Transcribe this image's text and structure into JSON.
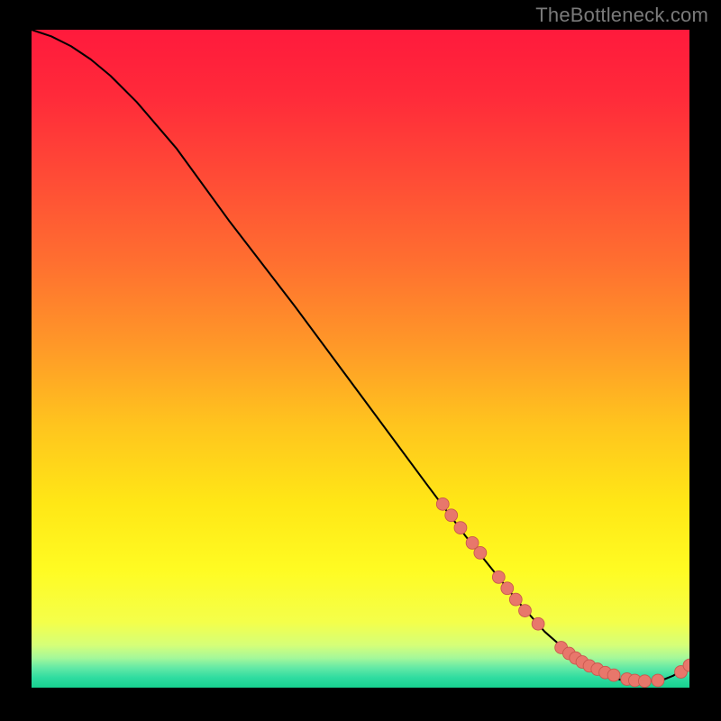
{
  "watermark": "TheBottleneck.com",
  "colors": {
    "gradient_stops": [
      {
        "offset": 0.0,
        "color": "#ff1a3c"
      },
      {
        "offset": 0.1,
        "color": "#ff2a3a"
      },
      {
        "offset": 0.22,
        "color": "#ff4a36"
      },
      {
        "offset": 0.35,
        "color": "#ff6e30"
      },
      {
        "offset": 0.48,
        "color": "#ff9828"
      },
      {
        "offset": 0.6,
        "color": "#ffc41e"
      },
      {
        "offset": 0.72,
        "color": "#ffe716"
      },
      {
        "offset": 0.82,
        "color": "#fffb22"
      },
      {
        "offset": 0.9,
        "color": "#f4ff4a"
      },
      {
        "offset": 0.935,
        "color": "#d6ff78"
      },
      {
        "offset": 0.955,
        "color": "#a4f89a"
      },
      {
        "offset": 0.97,
        "color": "#63e9a6"
      },
      {
        "offset": 0.985,
        "color": "#2fdca0"
      },
      {
        "offset": 1.0,
        "color": "#17d08f"
      }
    ],
    "curve": "#000000",
    "marker_fill": "#e8776b",
    "marker_stroke": "#c9574e"
  },
  "chart_data": {
    "type": "line",
    "title": "",
    "xlabel": "",
    "ylabel": "",
    "xlim": [
      0,
      100
    ],
    "ylim": [
      0,
      100
    ],
    "series": [
      {
        "name": "curve",
        "x": [
          0,
          3,
          6,
          9,
          12,
          16,
          22,
          30,
          40,
          50,
          60,
          66,
          70,
          74,
          78,
          82,
          85,
          87,
          89.5,
          92,
          94,
          96,
          97.5,
          100
        ],
        "y": [
          100,
          99,
          97.5,
          95.5,
          93,
          89,
          82,
          71,
          58,
          44.5,
          31,
          23,
          18,
          13,
          8.5,
          5,
          3,
          2,
          1.2,
          1,
          1,
          1.2,
          1.8,
          3.4
        ]
      }
    ],
    "markers": {
      "name": "highlighted-points",
      "x": [
        62.5,
        63.8,
        65.2,
        67,
        68.2,
        71,
        72.3,
        73.6,
        75,
        77,
        80.5,
        81.7,
        82.7,
        83.7,
        84.8,
        86,
        87.2,
        88.5,
        90.5,
        91.7,
        93.2,
        95.2,
        98.7,
        100
      ],
      "y": [
        27.9,
        26.2,
        24.3,
        22,
        20.5,
        16.8,
        15.1,
        13.4,
        11.7,
        9.7,
        6.1,
        5.2,
        4.5,
        3.9,
        3.3,
        2.8,
        2.3,
        1.9,
        1.3,
        1.1,
        1.0,
        1.1,
        2.4,
        3.4
      ]
    }
  }
}
